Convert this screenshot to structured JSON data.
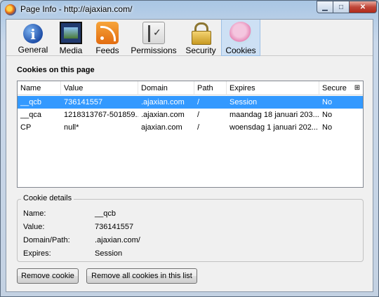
{
  "window": {
    "title": "Page Info - http://ajaxian.com/"
  },
  "tabs": [
    {
      "label": "General",
      "icon": "general-info-icon"
    },
    {
      "label": "Media",
      "icon": "media-icon"
    },
    {
      "label": "Feeds",
      "icon": "rss-feed-icon"
    },
    {
      "label": "Permissions",
      "icon": "permissions-icon"
    },
    {
      "label": "Security",
      "icon": "padlock-icon"
    },
    {
      "label": "Cookies",
      "icon": "cookie-icon",
      "active": true
    }
  ],
  "cookies": {
    "section_title": "Cookies on this page",
    "columns": [
      "Name",
      "Value",
      "Domain",
      "Path",
      "Expires",
      "Secure"
    ],
    "rows": [
      {
        "name": "__qcb",
        "value": "736141557",
        "domain": ".ajaxian.com",
        "path": "/",
        "expires": "Session",
        "secure": "No",
        "selected": true
      },
      {
        "name": "__qca",
        "value": "1218313767-501859...",
        "domain": ".ajaxian.com",
        "path": "/",
        "expires": "maandag 18 januari 203...",
        "secure": "No"
      },
      {
        "name": "CP",
        "value": "null*",
        "domain": "ajaxian.com",
        "path": "/",
        "expires": "woensdag 1 januari 202...",
        "secure": "No"
      }
    ]
  },
  "details": {
    "legend": "Cookie details",
    "name_label": "Name:",
    "name_value": "__qcb",
    "value_label": "Value:",
    "value_value": "736141557",
    "domain_label": "Domain/Path:",
    "domain_value": ".ajaxian.com/",
    "expires_label": "Expires:",
    "expires_value": "Session"
  },
  "buttons": {
    "remove": "Remove cookie",
    "remove_all": "Remove all cookies in this list"
  },
  "colors": {
    "selection": "#3399ff",
    "active_tab": "#cde0f4"
  }
}
